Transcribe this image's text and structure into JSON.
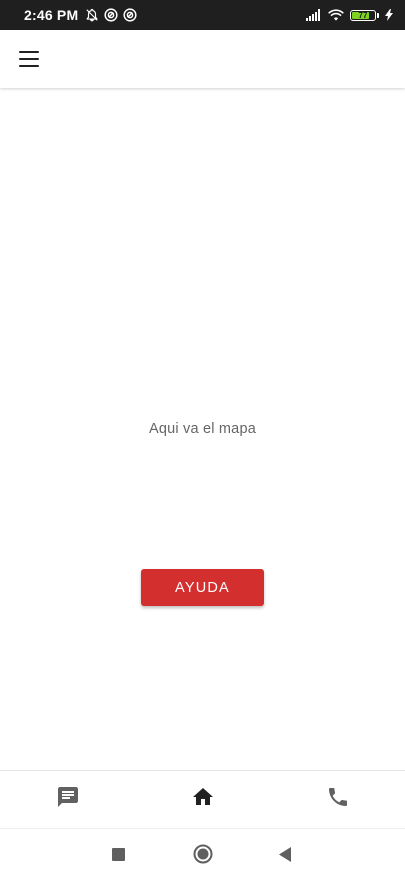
{
  "status_bar": {
    "time": "2:46 PM",
    "battery_level": "77",
    "battery_fraction": 0.77,
    "icons": [
      "notifications-off-icon",
      "sync-circle-icon",
      "sync-circle-icon",
      "signal-icon",
      "wifi-icon",
      "battery-icon",
      "charging-bolt-icon"
    ]
  },
  "app_bar": {
    "menu_icon": "hamburger-menu-icon"
  },
  "main": {
    "map_placeholder": "Aqui va el mapa",
    "help_button_label": "AYUDA"
  },
  "bottom_nav": {
    "items": [
      {
        "icon": "chat-icon",
        "selected": false
      },
      {
        "icon": "home-icon",
        "selected": true
      },
      {
        "icon": "phone-icon",
        "selected": false
      }
    ]
  },
  "system_nav": {
    "buttons": [
      "recents-square-icon",
      "home-circle-icon",
      "back-triangle-icon"
    ]
  },
  "colors": {
    "status_bar_bg": "#1f1f1f",
    "accent_red": "#d32f2f",
    "battery_green": "#7ed321",
    "nav_icon_inactive": "#616161",
    "nav_icon_active": "#212121"
  }
}
